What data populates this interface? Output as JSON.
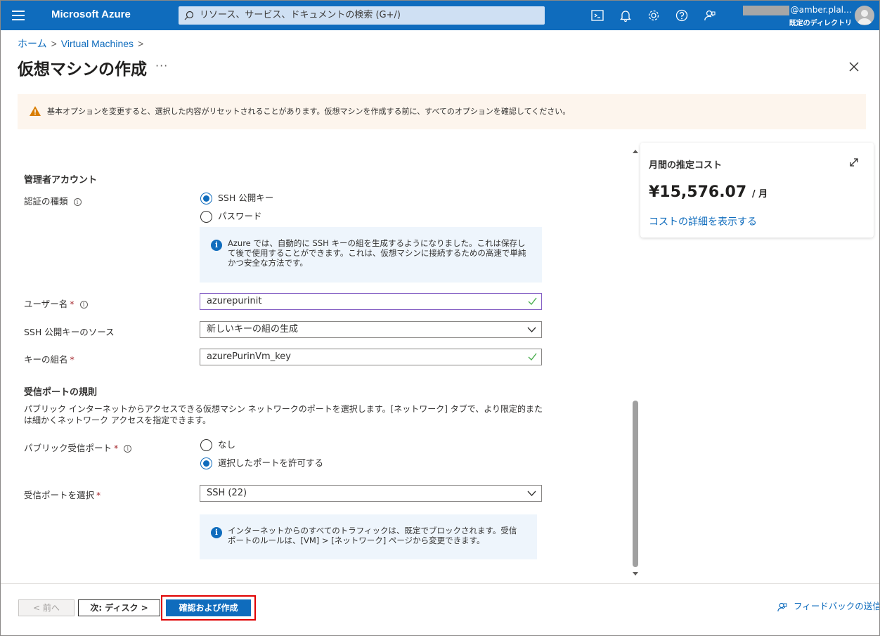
{
  "topbar": {
    "brand": "Microsoft Azure",
    "search_placeholder": "リソース、サービス、ドキュメントの検索 (G+/)",
    "account_email": "@amber.plal…",
    "account_directory": "既定のディレクトリ",
    "icons": [
      "cloud-shell-icon",
      "bell-icon",
      "gear-icon",
      "help-icon",
      "feedback-icon"
    ]
  },
  "breadcrumb": {
    "home": "ホーム",
    "vms": "Virtual Machines",
    "sep": ">"
  },
  "page": {
    "title": "仮想マシンの作成",
    "more": "···"
  },
  "warning": {
    "text": "基本オプションを変更すると、選択した内容がリセットされることがあります。仮想マシンを作成する前に、すべてのオプションを確認してください。"
  },
  "admin": {
    "section_title": "管理者アカウント",
    "auth_label": "認証の種類",
    "auth_options": [
      "SSH 公開キー",
      "パスワード"
    ],
    "auth_selected": "SSH 公開キー",
    "ssh_info": "Azure では、自動的に SSH キーの組を生成するようになりました。これは保存して後で使用することができます。これは、仮想マシンに接続するための高速で単純かつ安全な方法です。",
    "username_label": "ユーザー名",
    "username_value": "azurepurinit",
    "keysource_label": "SSH 公開キーのソース",
    "keysource_value": "新しいキーの組の生成",
    "keyname_label": "キーの組名",
    "keyname_value": "azurePurinVm_key"
  },
  "inbound": {
    "section_title": "受信ポートの規則",
    "description": "パブリック インターネットからアクセスできる仮想マシン ネットワークのポートを選択します。[ネットワーク] タブで、より限定的または細かくネットワーク アクセスを指定できます。",
    "public_ports_label": "パブリック受信ポート",
    "port_options": [
      "なし",
      "選択したポートを許可する"
    ],
    "port_selected": "選択したポートを許可する",
    "select_ports_label": "受信ポートを選択",
    "select_ports_value": "SSH (22)",
    "ports_info": "インターネットからのすべてのトラフィックは、既定でブロックされます。受信ポートのルールは、[VM] > [ネットワーク] ページから変更できます。"
  },
  "cost": {
    "title": "月間の推定コスト",
    "amount": "¥15,576.07",
    "unit": "/ 月",
    "details_link": "コストの詳細を表示する"
  },
  "footer": {
    "prev": "< 前へ",
    "next": "次: ディスク >",
    "create": "確認および作成",
    "feedback": "フィードバックの送信"
  },
  "colors": {
    "accent": "#0f6cbd",
    "warning_bg": "#fdf5ed",
    "warning_icon": "#d97d00",
    "highlight": "#e00000",
    "valid": "#4caf50"
  }
}
